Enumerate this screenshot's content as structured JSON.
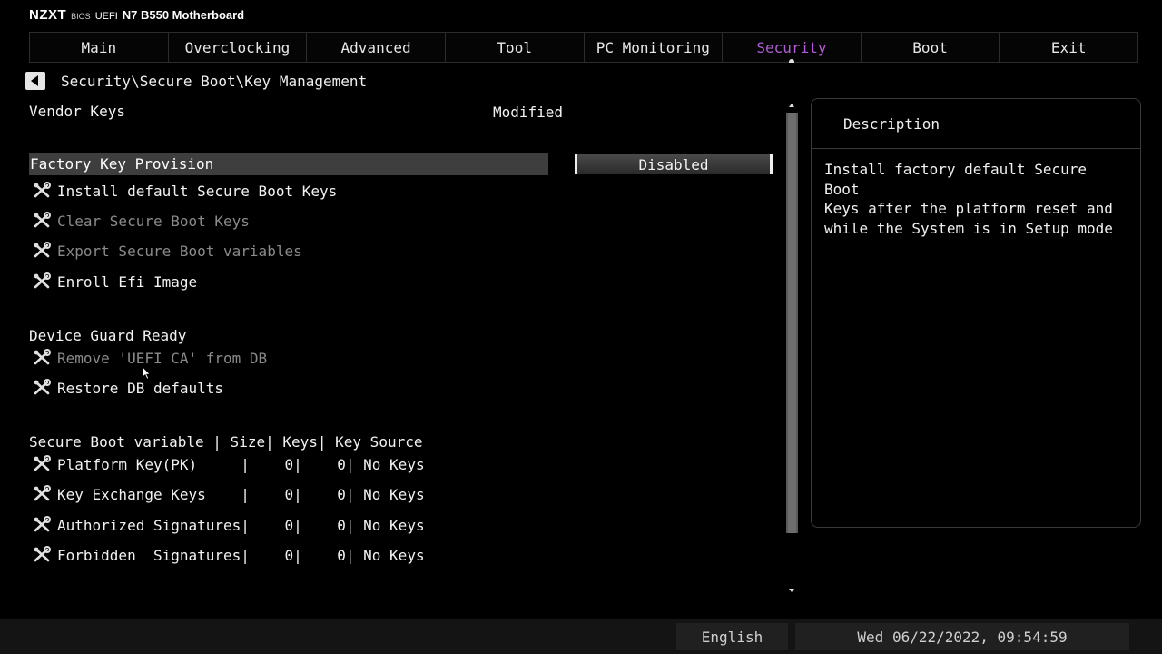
{
  "brand": {
    "logo": "NZXT",
    "bios": "BIOS",
    "uefi": "UEFI",
    "model": "N7 B550 Motherboard"
  },
  "menu": {
    "tabs": [
      {
        "label": "Main"
      },
      {
        "label": "Overclocking"
      },
      {
        "label": "Advanced"
      },
      {
        "label": "Tool"
      },
      {
        "label": "PC Monitoring"
      },
      {
        "label": "Security"
      },
      {
        "label": "Boot"
      },
      {
        "label": "Exit"
      }
    ],
    "active": "Security",
    "accent_color": "#b25bd6"
  },
  "breadcrumb": "Security\\Secure Boot\\Key Management",
  "vendor_keys": {
    "label": "Vendor Keys",
    "value": "Modified"
  },
  "factory_key_provision": {
    "label": "Factory Key Provision",
    "value": "Disabled"
  },
  "actions": [
    {
      "label": "Install default Secure Boot Keys",
      "icon": "wrench-icon",
      "enabled": true
    },
    {
      "label": "Clear Secure Boot Keys",
      "icon": "wrench-icon",
      "enabled": false
    },
    {
      "label": "Export Secure Boot variables",
      "icon": "wrench-icon",
      "enabled": false
    },
    {
      "label": "Enroll Efi Image",
      "icon": "wrench-icon",
      "enabled": true
    }
  ],
  "device_guard": {
    "label": "Device Guard Ready",
    "items": [
      {
        "label": "Remove 'UEFI CA' from DB",
        "icon": "wrench-icon",
        "enabled": false
      },
      {
        "label": "Restore DB defaults",
        "icon": "wrench-icon",
        "enabled": true
      }
    ]
  },
  "variables_table": {
    "header": "Secure Boot variable | Size| Keys| Key Source",
    "rows": [
      {
        "label": "Platform Key(PK)     |    0|    0| No Keys",
        "icon": "wrench-icon"
      },
      {
        "label": "Key Exchange Keys    |    0|    0| No Keys",
        "icon": "wrench-icon"
      },
      {
        "label": "Authorized Signatures|    0|    0| No Keys",
        "icon": "wrench-icon"
      },
      {
        "label": "Forbidden  Signatures|    0|    0| No Keys",
        "icon": "wrench-icon"
      }
    ]
  },
  "description": {
    "title": "Description",
    "text": "Install factory default Secure Boot\nKeys after the platform reset and\nwhile the System is in Setup mode"
  },
  "footer": {
    "language": "English",
    "datetime": "Wed 06/22/2022, 09:54:59"
  }
}
